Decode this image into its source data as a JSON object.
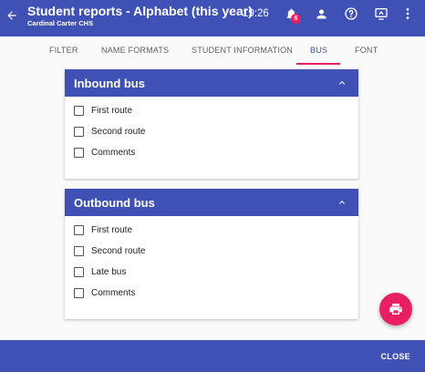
{
  "header": {
    "title": "Student reports - Alphabet (this year)",
    "subtitle": "Cardinal Carter CHS",
    "time": "19:26",
    "notification_count": "6",
    "icons": [
      "back-arrow-icon",
      "bell-icon",
      "person-icon",
      "help-icon",
      "screen-share-icon",
      "more-vert-icon"
    ]
  },
  "tabs": [
    {
      "label": "FILTER",
      "active": false
    },
    {
      "label": "NAME FORMATS",
      "active": false
    },
    {
      "label": "STUDENT INFORMATION",
      "active": false
    },
    {
      "label": "BUS",
      "active": true
    },
    {
      "label": "FONT",
      "active": false
    }
  ],
  "inbound": {
    "title": "Inbound bus",
    "options": [
      "First route",
      "Second route",
      "Comments"
    ]
  },
  "outbound": {
    "title": "Outbound bus",
    "options": [
      "First route",
      "Second route",
      "Late bus",
      "Comments"
    ]
  },
  "fab": {
    "icon": "print-icon"
  },
  "footer": {
    "close_label": "CLOSE"
  },
  "colors": {
    "primary": "#3f51b5",
    "accent": "#e91e63"
  }
}
